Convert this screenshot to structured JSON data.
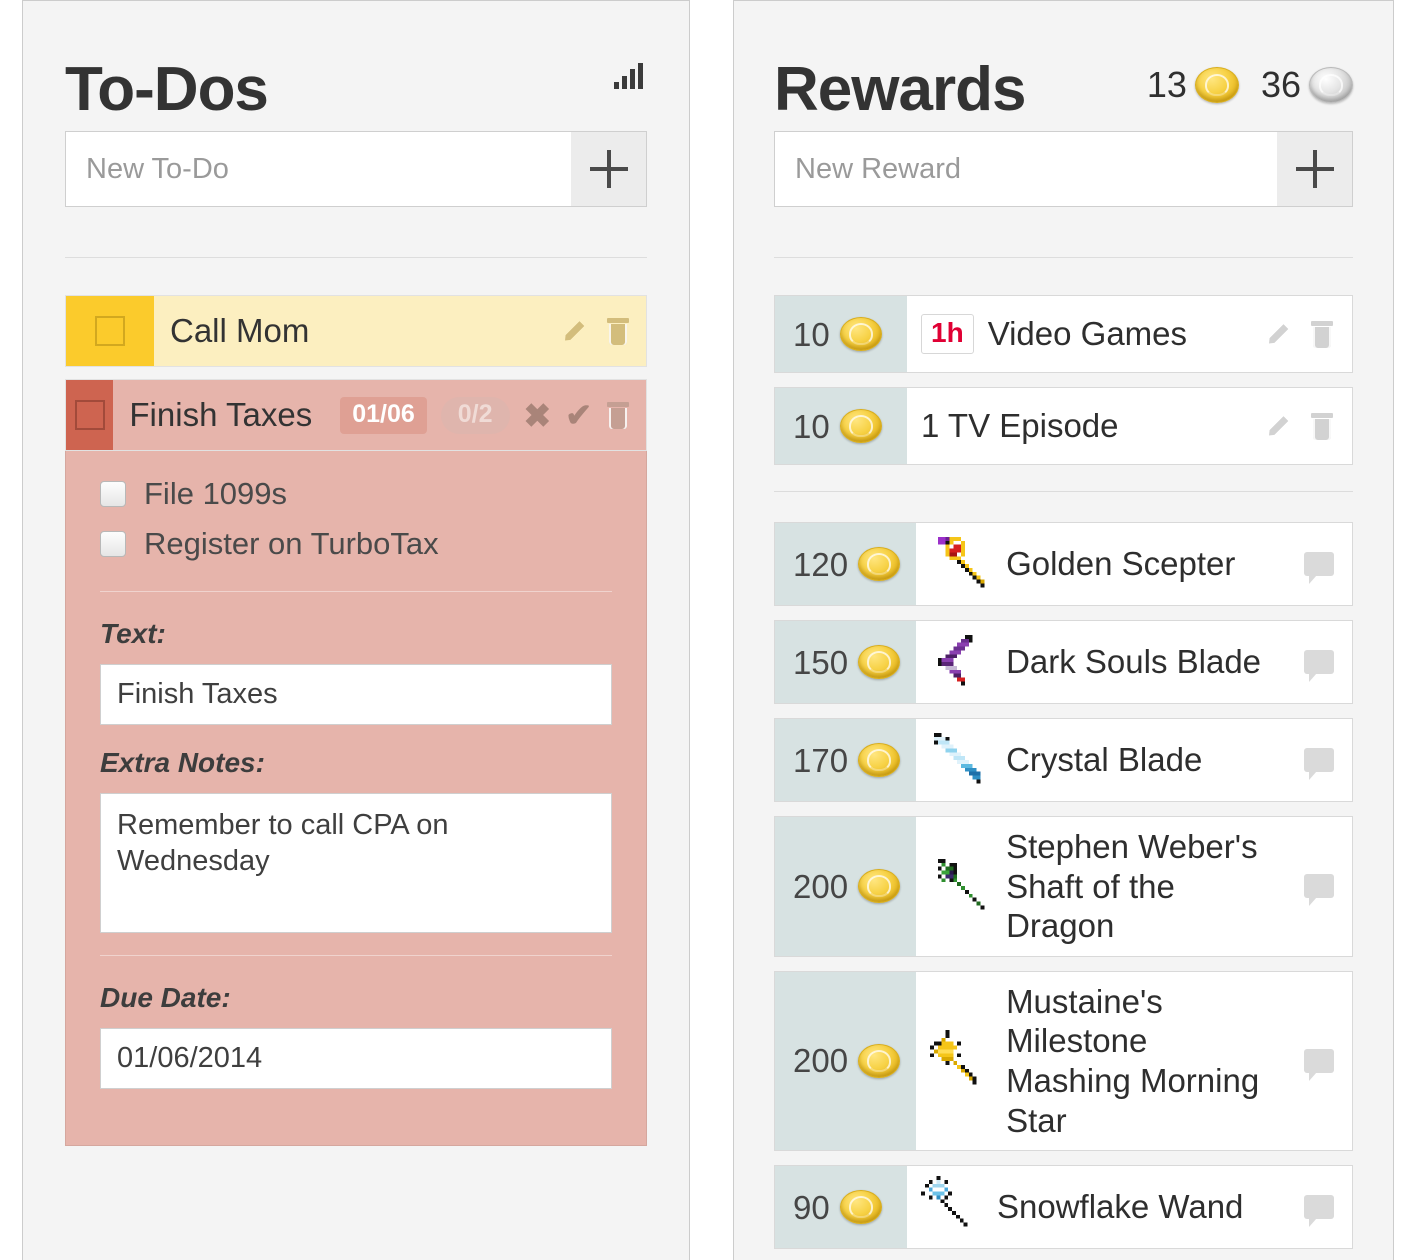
{
  "todos_panel": {
    "title": "To-Dos",
    "stats_icon": "bar-chart-icon",
    "new_entry": {
      "placeholder": "New To-Do",
      "add_label": "+"
    },
    "items": [
      {
        "text": "Call Mom",
        "color": "#FBCB2C",
        "body_color": "#FCEFC0",
        "expanded": false,
        "actions": [
          "edit-icon",
          "delete-icon"
        ]
      },
      {
        "text": "Finish Taxes",
        "color": "#CE6450",
        "body_color": "#E6B4AB",
        "expanded": true,
        "date_badge": "01/06",
        "progress_badge": "0/2",
        "actions": [
          "cancel-icon",
          "confirm-icon",
          "delete-icon"
        ],
        "subtasks": [
          {
            "label": "File 1099s",
            "checked": false
          },
          {
            "label": "Register on TurboTax",
            "checked": false
          }
        ],
        "fields": {
          "text_label": "Text:",
          "text_value": "Finish Taxes",
          "notes_label": "Extra Notes:",
          "notes_value": "Remember to call CPA on Wednesday",
          "due_label": "Due Date:",
          "due_value": "01/06/2014"
        }
      }
    ]
  },
  "rewards_panel": {
    "title": "Rewards",
    "currency": [
      {
        "amount": "13",
        "type": "gold-coin"
      },
      {
        "amount": "36",
        "type": "silver-coin"
      }
    ],
    "new_entry": {
      "placeholder": "New Reward",
      "add_label": "+"
    },
    "custom_rewards": [
      {
        "price": "10",
        "coin": "gold-coin",
        "time_badge": "1h",
        "name": "Video Games",
        "actions": [
          "edit-icon",
          "delete-icon"
        ]
      },
      {
        "price": "10",
        "coin": "gold-coin",
        "time_badge": null,
        "name": "1 TV Episode",
        "actions": [
          "edit-icon",
          "delete-icon"
        ]
      }
    ],
    "item_rewards": [
      {
        "price": "120",
        "coin": "gold-coin",
        "name": "Golden Scepter",
        "sprite": "golden-scepter-sprite",
        "actions": [
          "comment-icon"
        ]
      },
      {
        "price": "150",
        "coin": "gold-coin",
        "name": "Dark Souls Blade",
        "sprite": "dark-souls-blade-sprite",
        "actions": [
          "comment-icon"
        ]
      },
      {
        "price": "170",
        "coin": "gold-coin",
        "name": "Crystal Blade",
        "sprite": "crystal-blade-sprite",
        "actions": [
          "comment-icon"
        ]
      },
      {
        "price": "200",
        "coin": "gold-coin",
        "name": "Stephen Weber's Shaft of the Dragon",
        "sprite": "dragon-shaft-sprite",
        "actions": [
          "comment-icon"
        ]
      },
      {
        "price": "200",
        "coin": "gold-coin",
        "name": "Mustaine's Milestone Mashing Morning Star",
        "sprite": "morning-star-sprite",
        "actions": [
          "comment-icon"
        ]
      },
      {
        "price": "90",
        "coin": "gold-coin",
        "name": "Snowflake Wand",
        "sprite": "snowflake-wand-sprite",
        "actions": [
          "comment-icon"
        ]
      }
    ]
  },
  "colors": {
    "gold": "#F7D247",
    "silver": "#D8D8D8",
    "todo_yellow": "#FBCB2C",
    "todo_red": "#CE6450",
    "price_bg": "#D7E2E2",
    "badge_red": "#E00034"
  }
}
